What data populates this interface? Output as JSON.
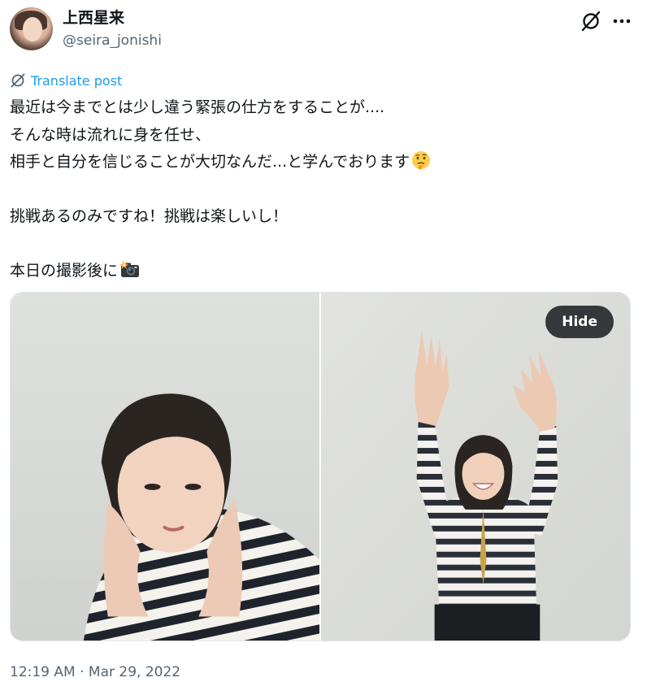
{
  "author": {
    "display_name": "上西星来",
    "handle": "@seira_jonishi"
  },
  "icons": {
    "grok": "grok-icon",
    "more": "more-dots-icon",
    "translate": "translate-icon",
    "thinking_emoji": "thinking-face-emoji",
    "camera_emoji": "camera-flash-emoji"
  },
  "translate_label": "Translate post",
  "tweet": {
    "lines": [
      "最近は今までとは少し違う緊張の仕方をすることが....",
      "そんな時は流れに身を任せ、",
      "相手と自分を信じることが大切なんだ...と学んでおります",
      "",
      "挑戦あるのみですね！挑戦は楽しいし！",
      "",
      "本日の撮影後に"
    ]
  },
  "media": {
    "hide_label": "Hide"
  },
  "timestamp": "12:19 AM · Mar 29, 2022",
  "colors": {
    "accent": "#1d9bf0",
    "secondary_text": "#536471",
    "primary_text": "#0f1419"
  }
}
